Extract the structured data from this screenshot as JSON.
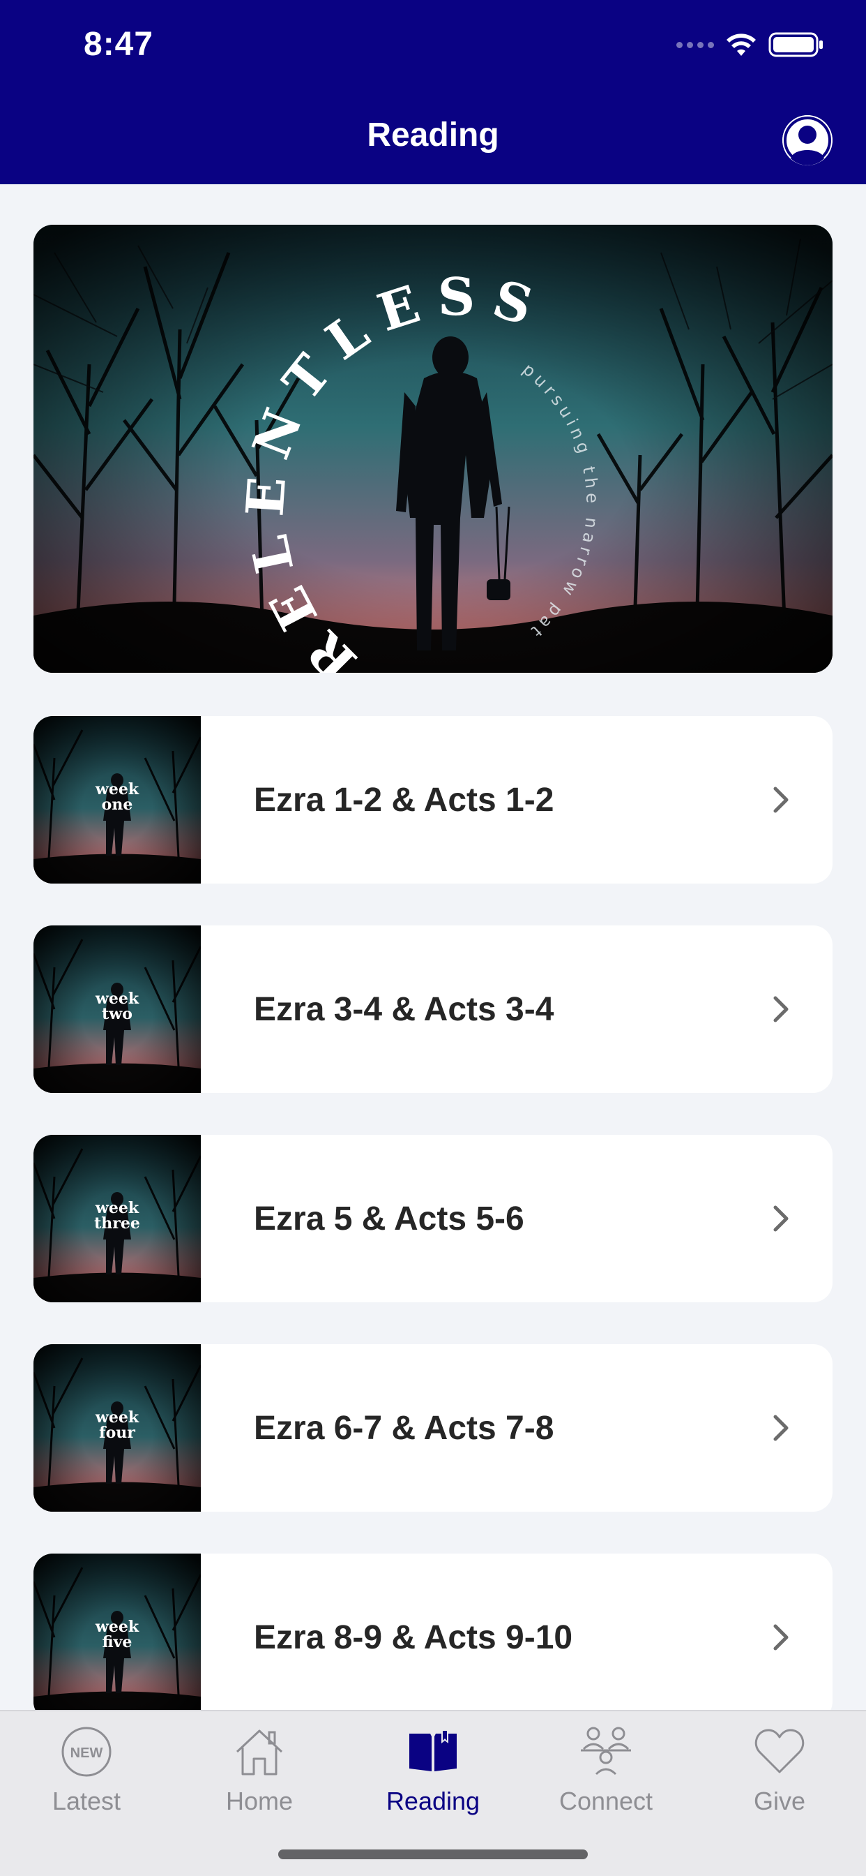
{
  "status_bar": {
    "time": "8:47"
  },
  "header": {
    "title": "Reading"
  },
  "hero": {
    "title": "RELENTLESS",
    "subtitle": "pursuing the narrow path"
  },
  "readings": [
    {
      "thumb_line1": "week",
      "thumb_line2": "one",
      "title": "Ezra 1-2 & Acts 1-2"
    },
    {
      "thumb_line1": "week",
      "thumb_line2": "two",
      "title": "Ezra 3-4 & Acts 3-4"
    },
    {
      "thumb_line1": "week",
      "thumb_line2": "three",
      "title": "Ezra 5 & Acts 5-6"
    },
    {
      "thumb_line1": "week",
      "thumb_line2": "four",
      "title": "Ezra 6-7 & Acts 7-8"
    },
    {
      "thumb_line1": "week",
      "thumb_line2": "five",
      "title": "Ezra 8-9 & Acts 9-10"
    }
  ],
  "tabs": [
    {
      "label": "Latest",
      "icon": "new-badge-icon",
      "badge": "NEW"
    },
    {
      "label": "Home",
      "icon": "house-icon"
    },
    {
      "label": "Reading",
      "icon": "book-icon",
      "active": true
    },
    {
      "label": "Connect",
      "icon": "people-icon"
    },
    {
      "label": "Give",
      "icon": "heart-icon"
    }
  ],
  "colors": {
    "header_bg": "#0a0283",
    "accent": "#0a0283",
    "tab_inactive": "#8e8e93",
    "page_bg": "#f2f4f8"
  }
}
